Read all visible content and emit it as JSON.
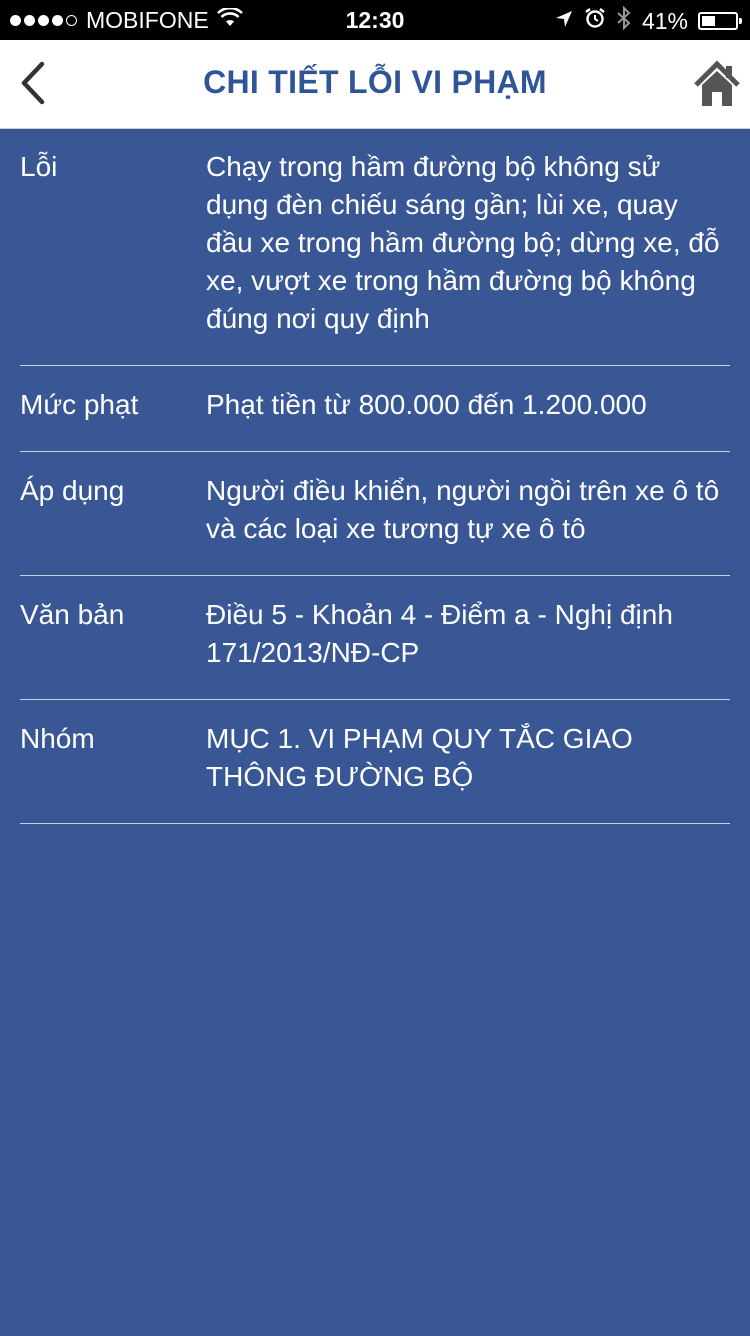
{
  "status_bar": {
    "carrier": "MOBIFONE",
    "time": "12:30",
    "battery_percent": "41%",
    "battery_level": 0.41,
    "signal_bars_filled": 4,
    "signal_bars_total": 5,
    "icons": [
      "wifi-icon",
      "location-arrow-icon",
      "alarm-icon",
      "bluetooth-icon",
      "battery-icon"
    ]
  },
  "nav": {
    "title": "CHI TIẾT LỖI VI PHẠM",
    "back_icon": "chevron-left-icon",
    "home_icon": "home-icon",
    "title_color": "#2f5597"
  },
  "colors": {
    "background": "#3a5795",
    "divider": "#c8d0e2"
  },
  "details": [
    {
      "label": "Lỗi",
      "value": "Chạy trong hầm đường bộ không sử dụng đèn chiếu sáng gần; lùi xe, quay đầu xe trong hầm đường bộ; dừng xe, đỗ xe, vượt xe trong hầm đường bộ không đúng nơi quy định"
    },
    {
      "label": "Mức phạt",
      "value": "Phạt tiền từ 800.000 đến 1.200.000"
    },
    {
      "label": "Áp dụng",
      "value": "Người điều khiển, người ngồi trên xe ô tô và các loại xe tương tự xe ô tô"
    },
    {
      "label": "Văn bản",
      "value": "Điều 5 - Khoản 4 - Điểm a - Nghị định 171/2013/NĐ-CP"
    },
    {
      "label": "Nhóm",
      "value": "MỤC 1. VI PHẠM QUY TẮC GIAO THÔNG ĐƯỜNG BỘ"
    }
  ]
}
